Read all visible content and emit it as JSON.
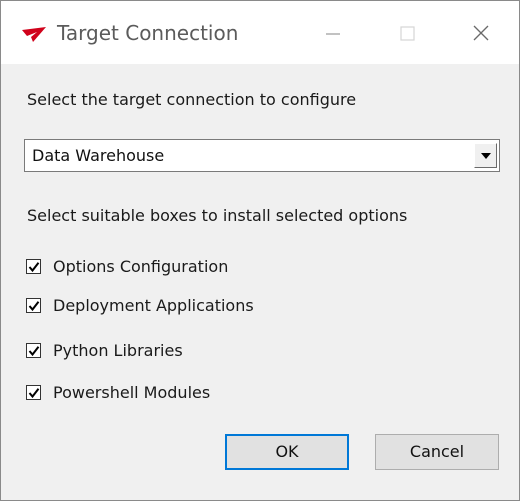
{
  "window": {
    "title": "Target Connection",
    "icon": "app-logo-icon",
    "controls": [
      "minimize-icon",
      "maximize-icon",
      "close-icon"
    ]
  },
  "main": {
    "connection_prompt": "Select the target connection to configure",
    "connection_select": {
      "selected": "Data Warehouse"
    },
    "options_prompt": "Select suitable boxes to install selected options",
    "options": [
      {
        "label": "Options Configuration",
        "checked": true
      },
      {
        "label": "Deployment Applications",
        "checked": true
      },
      {
        "label": "Python Libraries",
        "checked": true
      },
      {
        "label": "Powershell Modules",
        "checked": true
      }
    ]
  },
  "buttons": {
    "ok_label": "OK",
    "cancel_label": "Cancel"
  },
  "colors": {
    "accent": "#0078d7",
    "logo": "#d0021b",
    "dialog_bg": "#f0f0f0"
  }
}
